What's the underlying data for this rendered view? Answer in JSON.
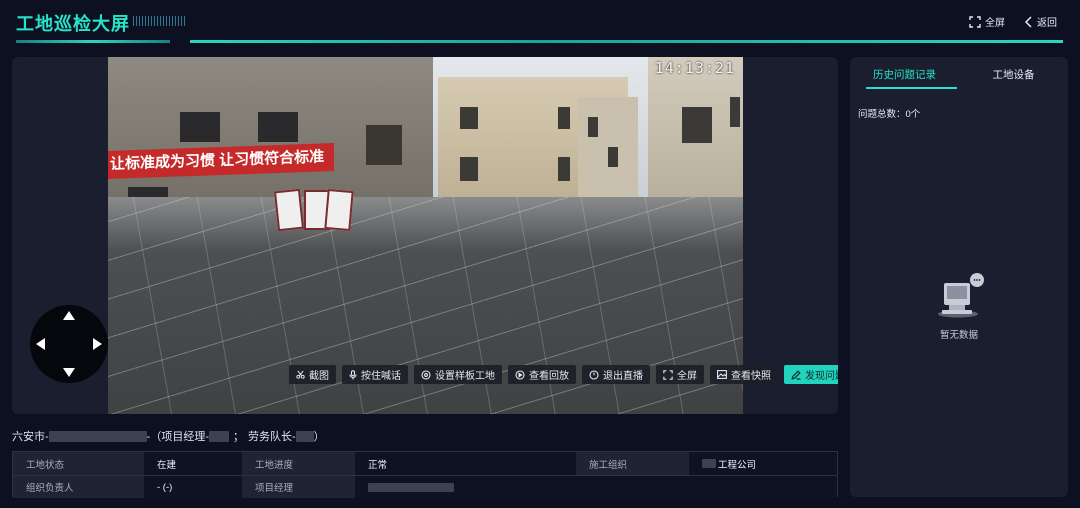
{
  "header": {
    "title": "工地巡检大屏",
    "fullscreen_label": "全屏",
    "back_label": "返回"
  },
  "video": {
    "timestamp": "14:13:21",
    "banner_text": "让标准成为习惯 让习惯符合标准",
    "toolbar": [
      {
        "icon": "scissors-icon",
        "label": "截图"
      },
      {
        "icon": "microphone-icon",
        "label": "按住喊话"
      },
      {
        "icon": "gear-circle-icon",
        "label": "设置样板工地"
      },
      {
        "icon": "play-circle-icon",
        "label": "查看回放"
      },
      {
        "icon": "power-icon",
        "label": "退出直播"
      },
      {
        "icon": "fullscreen-icon",
        "label": "全屏"
      },
      {
        "icon": "image-icon",
        "label": "查看快照"
      },
      {
        "icon": "pen-icon",
        "label": "发现问题"
      }
    ]
  },
  "project": {
    "city_prefix": "六安市-",
    "manager_prefix": "-（项目经理-",
    "separator": "；",
    "foreman_prefix": "劳务队长-",
    "close": "）"
  },
  "info": {
    "row1": [
      {
        "label": "工地状态",
        "value": "在建"
      },
      {
        "label": "工地进度",
        "value": "正常"
      },
      {
        "label": "施工组织",
        "value": "工程公司"
      }
    ],
    "row2": [
      {
        "label": "组织负责人",
        "value": "- (-)"
      },
      {
        "label": "项目经理",
        "value": ""
      }
    ]
  },
  "side": {
    "tab_history": "历史问题记录",
    "tab_devices": "工地设备",
    "issue_total": "问题总数：0个",
    "empty_text": "暂无数据"
  },
  "colors": {
    "accent": "#27e3c9",
    "background": "#0d1020",
    "panel": "#1a1e2e"
  }
}
